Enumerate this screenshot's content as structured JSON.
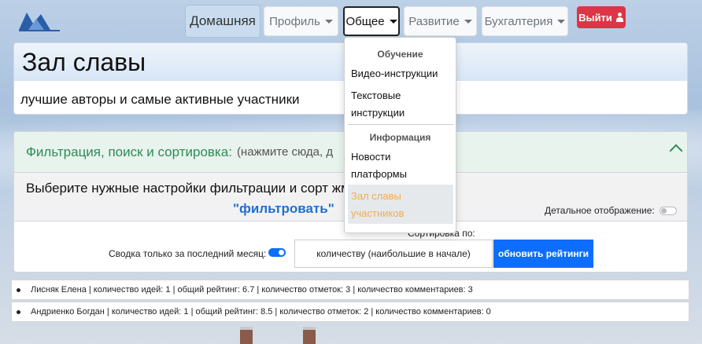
{
  "nav": {
    "home": "Домашняя",
    "profile": "Профиль",
    "general": "Общее",
    "development": "Развитие",
    "accounting": "Бухгалтерия",
    "logout": "Выйти"
  },
  "dropdown": {
    "section_learning": "Обучение",
    "video": "Видео-инструкции",
    "text_line1": "Текстовые",
    "text_line2": "инструкции",
    "section_info": "Информация",
    "news_line1": "Новости",
    "news_line2": "платформы",
    "hall_line1": "Зал славы",
    "hall_line2": "участников"
  },
  "hero": {
    "title": "Зал славы",
    "subtitle": "лучшие авторы и самые активные участники"
  },
  "filter": {
    "title": "Фильтрация, поиск и сортировка:",
    "hint": "(нажмите сюда, д",
    "instruction": "Выберите нужные настройки фильтрации и сорт                           жмите кнопку",
    "keyword": "\"фильтровать\"",
    "detail_label": "Детальное отображение:",
    "detail_on": false,
    "sort_label": "Сортировка по:",
    "month_label": "Сводка только за последний месяц:",
    "month_on": true,
    "sort_value": "количеству (наибольшие в начале)",
    "refresh_button": "обновить рейтинги"
  },
  "results": [
    "Лисняк Елена | количество идей: 1 | общий рейтинг: 6.7 | количество отметок: 3 | количество комментариев: 3",
    "Андриенко Богдан | количество идей: 1 | общий рейтинг: 8.5 | количество отметок: 2 | количество комментариев: 0"
  ],
  "colors": {
    "accent": "#0d6efd",
    "danger": "#dc3545",
    "success_text": "#2e8b57",
    "active_menu": "#f0ad4e"
  }
}
